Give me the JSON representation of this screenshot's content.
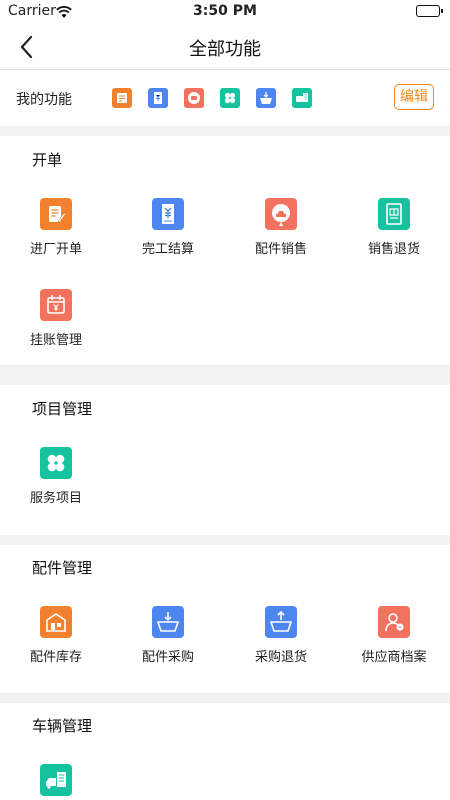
{
  "status_bar": {
    "carrier": "Carrier",
    "time": "3:50 PM"
  },
  "nav": {
    "title": "全部功能"
  },
  "my_functions": {
    "label": "我的功能",
    "edit_label": "编辑",
    "icons": [
      "orange-note-icon",
      "blue-receipt-icon",
      "red-parts-icon",
      "green-clover-icon",
      "blue-basket-icon",
      "green-car-shop-icon"
    ]
  },
  "sections": [
    {
      "title": "开单",
      "items": [
        {
          "label": "进厂开单",
          "icon": "pencil-note-icon",
          "color": "#f1812d"
        },
        {
          "label": "完工结算",
          "icon": "receipt-yen-icon",
          "color": "#4c86ee"
        },
        {
          "label": "配件销售",
          "icon": "parts-sale-icon",
          "color": "#f2725f"
        },
        {
          "label": "销售退货",
          "icon": "return-doc-icon",
          "color": "#17c2a0"
        },
        {
          "label": "挂账管理",
          "icon": "calendar-yen-icon",
          "color": "#f2725f"
        }
      ]
    },
    {
      "title": "项目管理",
      "items": [
        {
          "label": "服务项目",
          "icon": "clover-icon",
          "color": "#17c2a0"
        }
      ]
    },
    {
      "title": "配件管理",
      "items": [
        {
          "label": "配件库存",
          "icon": "warehouse-icon",
          "color": "#f1812d"
        },
        {
          "label": "配件采购",
          "icon": "basket-in-icon",
          "color": "#4c86ee"
        },
        {
          "label": "采购退货",
          "icon": "basket-out-icon",
          "color": "#4c86ee"
        },
        {
          "label": "供应商档案",
          "icon": "supplier-profile-icon",
          "color": "#f2725f"
        }
      ]
    },
    {
      "title": "车辆管理",
      "items": [
        {
          "label": "",
          "icon": "vehicle-file-icon",
          "color": "#17c2a0"
        }
      ]
    }
  ]
}
